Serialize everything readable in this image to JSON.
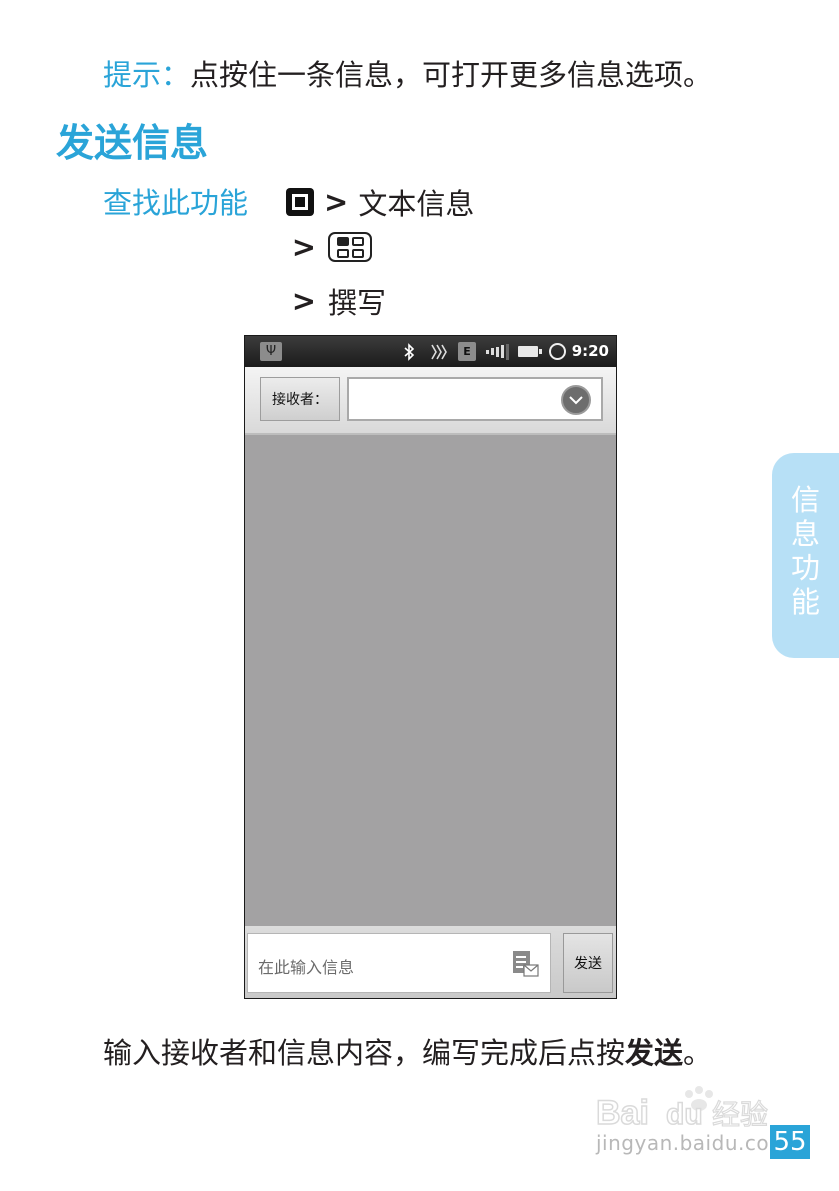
{
  "tip": {
    "label": "提示：",
    "text": "点按住一条信息，可打开更多信息选项。"
  },
  "heading": "发送信息",
  "find_feature": {
    "label": "查找此功能",
    "step1": "文本信息",
    "step3": "撰写",
    "separator": ">"
  },
  "phone": {
    "status_bar": {
      "time": "9:20",
      "icons": [
        "usb-icon",
        "bluetooth-icon",
        "nfc-icon",
        "edge-network-icon",
        "signal-icon",
        "battery-icon",
        "alarm-icon"
      ],
      "edge_letter": "E"
    },
    "recipient_label": "接收者：",
    "compose_placeholder": "在此输入信息",
    "send_label": "发送"
  },
  "body": {
    "text_before": "输入接收者和信息内容，编写完成后点按",
    "emphasis": "发送",
    "text_after": "。"
  },
  "side_tab": "信息功能",
  "watermark": {
    "logo_text": "Baidu经验",
    "url": "jingyan.baidu.com"
  },
  "page_number": "55",
  "colors": {
    "accent": "#2aa4d8",
    "side_tab": "#b7e0f6",
    "phone_background": "#a3a2a3"
  }
}
